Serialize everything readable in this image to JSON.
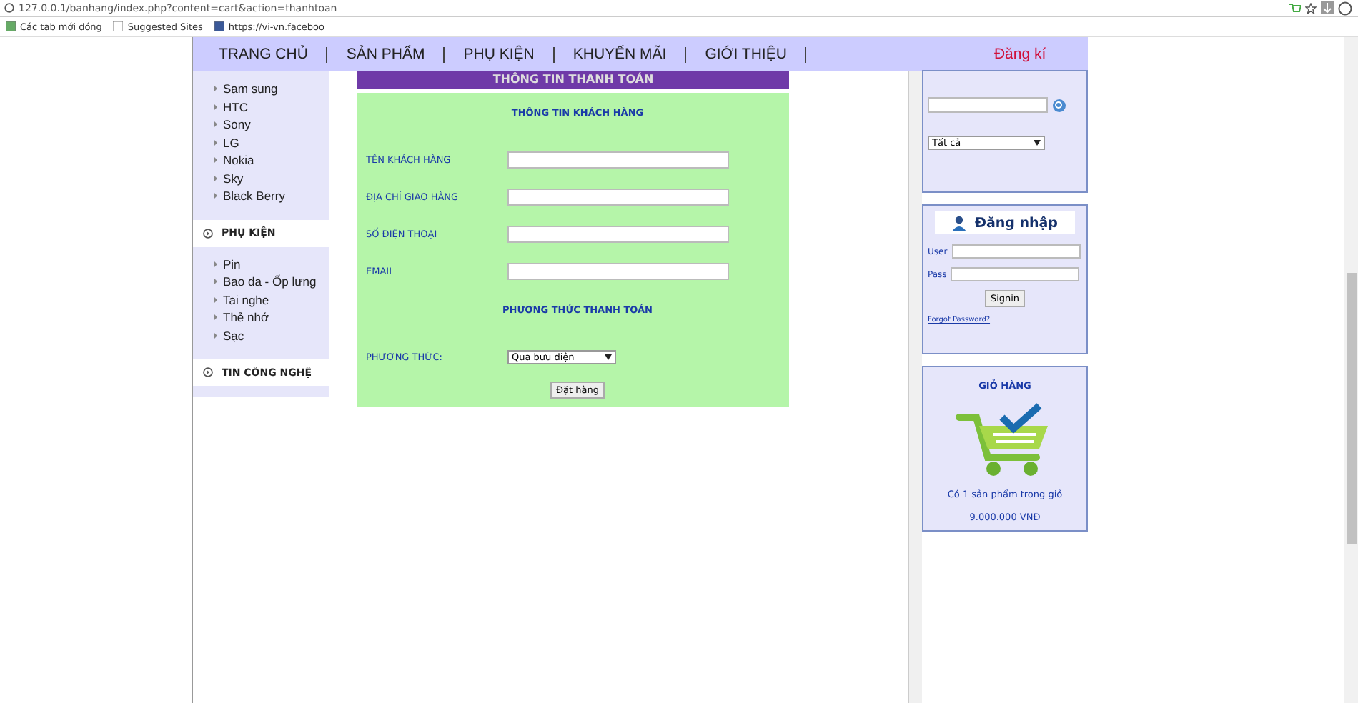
{
  "browser": {
    "url": "127.0.0.1/banhang/index.php?content=cart&action=thanhtoan",
    "bookmarks": [
      {
        "label": "Các tab mới đóng"
      },
      {
        "label": "Suggested Sites"
      },
      {
        "label": "https://vi-vn.faceboo"
      }
    ]
  },
  "nav": {
    "items": [
      {
        "label": "TRANG CHỦ"
      },
      {
        "label": "SẢN PHẨM"
      },
      {
        "label": "PHỤ KIỆN"
      },
      {
        "label": "KHUYẾN MÃI"
      },
      {
        "label": "GIỚI THIỆU"
      }
    ],
    "register": "Đăng kí"
  },
  "sidebar": {
    "sections": [
      {
        "items": [
          "Sam sung",
          "HTC",
          "Sony",
          "LG",
          "Nokia",
          "Sky",
          "Black Berry"
        ]
      },
      {
        "title": "PHỤ KIỆN",
        "items": [
          "Pin",
          "Bao da - Ốp lưng",
          "Tai nghe",
          "Thẻ nhớ",
          "Sạc"
        ]
      },
      {
        "title": "TIN CÔNG NGHỆ"
      }
    ]
  },
  "checkout": {
    "title": "THÔNG TIN THANH TOÁN",
    "customer_heading": "THÔNG TIN KHÁCH HÀNG",
    "fields": [
      {
        "label": "TÊN KHÁCH HÀNG"
      },
      {
        "label": "ĐỊA CHỈ GIAO HÀNG"
      },
      {
        "label": "SỐ ĐIỆN THOẠI"
      },
      {
        "label": "EMAIL"
      }
    ],
    "payment_heading": "PHƯƠNG THỨC THANH TOÁN",
    "payment_label": "PHƯƠNG THỨC:",
    "payment_value": "Qua bưu điện",
    "submit": "Đặt hàng"
  },
  "search": {
    "category": "Tất cả"
  },
  "login": {
    "title": "Đăng nhập",
    "user_label": "User",
    "pass_label": "Pass",
    "submit": "Signin",
    "forgot": "Forgot Password?"
  },
  "cart": {
    "title": "GIỎ HÀNG",
    "summary": "Có 1 sản phẩm trong giỏ",
    "total": "9.000.000 VNĐ"
  }
}
